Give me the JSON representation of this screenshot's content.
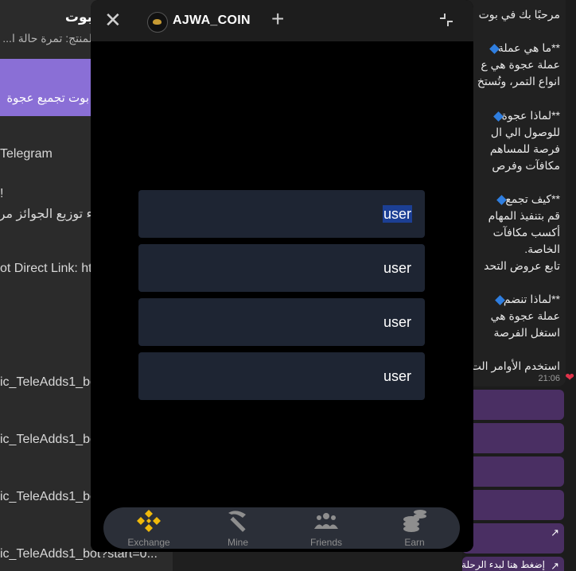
{
  "left_pane": {
    "title": "بوت",
    "subtitle": "لمنتج: تمرة حالة ا...",
    "button_label": "بوت تجميع عجوة",
    "lines": [
      "Telegram",
      "!",
      "ء توزيع الجوائز مر",
      "ot Direct Link: ht",
      "ic_TeleAdds1_bo",
      "ic_TeleAdds1_bo",
      "ic_TeleAdds1_bo",
      "ic_TeleAdds1_bot?start=0..."
    ]
  },
  "right_pane": {
    "lines": [
      "مرحبًا بك في بوت",
      "**ما هي عملة",
      "عملة عجوة هي ع",
      "انواع التمر، وتُستخ",
      "**لماذا عجوة",
      "للوصول الي ال",
      "فرصة للمساهم",
      "مكافآت وفرص",
      "**كيف تجمع",
      "قم بتنفيذ المهام",
      "أكسب مكافآت",
      "الخاصة.",
      "تابع عروض التحد",
      "**لماذا تنضم",
      "عملة عجوة هي",
      "استغل الفرصة",
      "استخدم الأوامر الت"
    ],
    "time": "21:06",
    "footer_text": "إضغط هنا لبدء الرحلة 🌟"
  },
  "miniapp": {
    "title": "AJWA_COIN",
    "cards": [
      {
        "label": "user"
      },
      {
        "label": "user"
      },
      {
        "label": "user"
      },
      {
        "label": "user"
      }
    ],
    "nav": [
      {
        "label": "Exchange",
        "icon": "binance-icon",
        "active": true
      },
      {
        "label": "Mine",
        "icon": "pickaxe-icon"
      },
      {
        "label": "Friends",
        "icon": "friends-icon"
      },
      {
        "label": "Earn",
        "icon": "coins-icon"
      }
    ]
  },
  "colors": {
    "accent_gold": "#f0b90b",
    "card_bg": "#1e2533",
    "selection": "#1c3f94",
    "purple_button": "#8a6fd6"
  }
}
